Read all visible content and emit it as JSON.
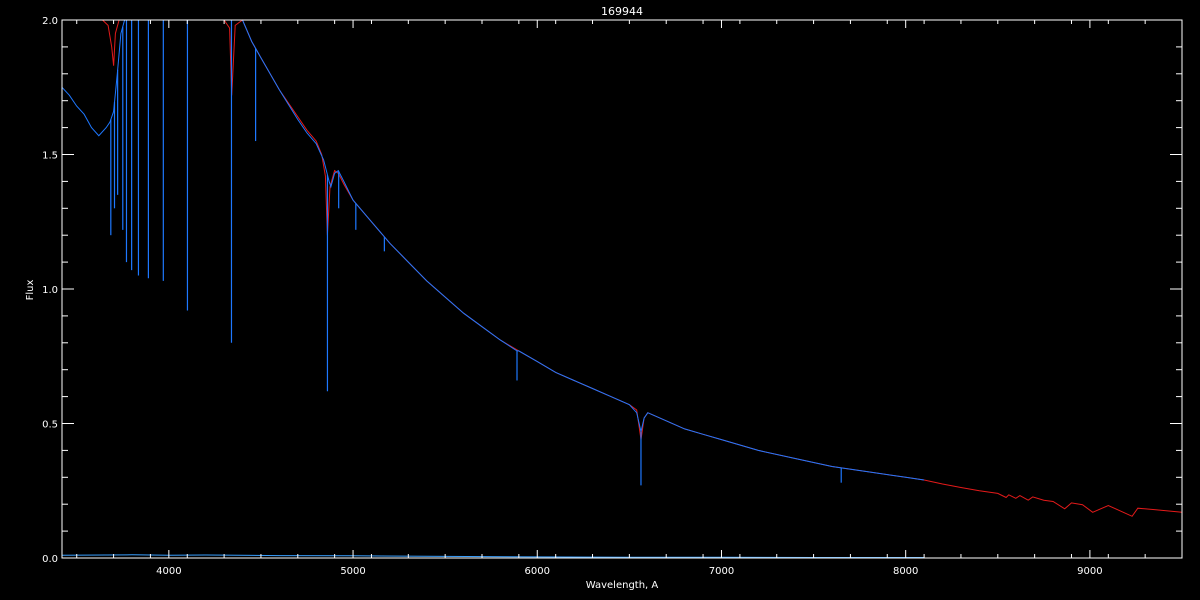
{
  "colors": {
    "background": "#000000",
    "axes": "#ffffff",
    "observed": "#1e78ff",
    "model": "#e41a1a",
    "error": "#3aa0ff"
  },
  "chart_data": {
    "type": "line",
    "title": "169944",
    "xlabel": "Wavelength, A",
    "ylabel": "Flux",
    "xlim": [
      3420,
      9500
    ],
    "ylim": [
      0.0,
      2.0
    ],
    "x_ticks": [
      4000,
      5000,
      6000,
      7000,
      8000,
      9000
    ],
    "y_ticks": [
      0.0,
      0.5,
      1.0,
      1.5,
      2.0
    ],
    "y_tick_labels": [
      "0.0",
      "0.5",
      "1.0",
      "1.5",
      "2.0"
    ],
    "grid": false,
    "legend": "none",
    "series": [
      {
        "color": "#e41a1a",
        "x": [
          3640,
          3670,
          3690,
          3700,
          3710,
          3730,
          3760,
          3800,
          4050,
          4100,
          4200,
          4300,
          4330,
          4341,
          4360,
          4400,
          4450,
          4500,
          4600,
          4700,
          4750,
          4800,
          4830,
          4850,
          4861,
          4875,
          4900,
          4920,
          4950,
          5000,
          5100,
          5200,
          5300,
          5400,
          5500,
          5600,
          5700,
          5800,
          5900,
          6000,
          6100,
          6200,
          6300,
          6400,
          6500,
          6540,
          6563,
          6580,
          6600,
          6700,
          6800,
          6900,
          7000,
          7200,
          7400,
          7600,
          7800,
          8000,
          8100,
          8200,
          8300,
          8400,
          8500,
          8545,
          8560,
          8598,
          8620,
          8665,
          8690,
          8750,
          8800,
          8863,
          8900,
          8960,
          9015,
          9100,
          9229,
          9260,
          9350,
          9500
        ],
        "y": [
          2.0,
          1.98,
          1.9,
          1.83,
          1.95,
          2.0,
          2.0,
          2.0,
          2.0,
          2.0,
          2.0,
          2.0,
          1.97,
          1.72,
          1.98,
          2.0,
          1.92,
          1.86,
          1.74,
          1.64,
          1.59,
          1.55,
          1.5,
          1.42,
          1.2,
          1.38,
          1.44,
          1.43,
          1.39,
          1.33,
          1.25,
          1.17,
          1.1,
          1.03,
          0.97,
          0.91,
          0.86,
          0.81,
          0.77,
          0.73,
          0.69,
          0.66,
          0.63,
          0.6,
          0.57,
          0.55,
          0.44,
          0.52,
          0.54,
          0.51,
          0.48,
          0.46,
          0.44,
          0.4,
          0.37,
          0.34,
          0.32,
          0.3,
          0.29,
          0.275,
          0.262,
          0.25,
          0.24,
          0.225,
          0.235,
          0.222,
          0.232,
          0.215,
          0.227,
          0.215,
          0.21,
          0.183,
          0.205,
          0.198,
          0.17,
          0.195,
          0.155,
          0.185,
          0.18,
          0.17
        ]
      },
      {
        "color": "#1e78ff",
        "x": [
          3420,
          3460,
          3500,
          3540,
          3580,
          3620,
          3660,
          3680,
          3700,
          3720,
          3740,
          3760,
          3780,
          3800,
          3900,
          4000,
          4050,
          4100,
          4200,
          4300,
          4350,
          4400,
          4450,
          4500,
          4600,
          4700,
          4750,
          4800,
          4840,
          4870,
          4880,
          4900,
          4920,
          4950,
          5000,
          5100,
          5200,
          5300,
          5400,
          5500,
          5600,
          5700,
          5800,
          5890,
          5900,
          6000,
          6100,
          6200,
          6300,
          6400,
          6500,
          6540,
          6563,
          6580,
          6600,
          6700,
          6800,
          6900,
          7000,
          7200,
          7400,
          7600,
          7800,
          8000,
          8100
        ],
        "y": [
          1.75,
          1.72,
          1.68,
          1.65,
          1.6,
          1.57,
          1.6,
          1.62,
          1.66,
          1.8,
          1.95,
          2.0,
          2.0,
          2.0,
          2.0,
          2.0,
          2.0,
          2.0,
          2.0,
          2.0,
          2.0,
          2.0,
          1.92,
          1.86,
          1.74,
          1.63,
          1.58,
          1.54,
          1.48,
          1.4,
          1.38,
          1.43,
          1.44,
          1.4,
          1.33,
          1.25,
          1.17,
          1.1,
          1.03,
          0.97,
          0.91,
          0.86,
          0.81,
          0.77,
          0.77,
          0.73,
          0.69,
          0.66,
          0.63,
          0.6,
          0.57,
          0.54,
          0.47,
          0.52,
          0.54,
          0.51,
          0.48,
          0.46,
          0.44,
          0.4,
          0.37,
          0.34,
          0.32,
          0.3,
          0.29
        ]
      },
      {
        "color": "#3aa0ff",
        "x": [
          3420,
          3800,
          4000,
          4200,
          4600,
          5000,
          5500,
          6000,
          6500,
          7000,
          7500,
          8100
        ],
        "y": [
          0.01,
          0.012,
          0.01,
          0.011,
          0.009,
          0.008,
          0.006,
          0.004,
          0.003,
          0.003,
          0.002,
          0.002
        ]
      }
    ],
    "absorption_lines": [
      {
        "x": 3685,
        "y": 1.2
      },
      {
        "x": 3705,
        "y": 1.3
      },
      {
        "x": 3722,
        "y": 1.35
      },
      {
        "x": 3750,
        "y": 1.22
      },
      {
        "x": 3770,
        "y": 1.1
      },
      {
        "x": 3798,
        "y": 1.07
      },
      {
        "x": 3835,
        "y": 1.05
      },
      {
        "x": 3889,
        "y": 1.04
      },
      {
        "x": 3970,
        "y": 1.03
      },
      {
        "x": 4101,
        "y": 0.92
      },
      {
        "x": 4340,
        "y": 0.8
      },
      {
        "x": 4471,
        "y": 1.55
      },
      {
        "x": 4861,
        "y": 0.62
      },
      {
        "x": 4922,
        "y": 1.3
      },
      {
        "x": 5015,
        "y": 1.22
      },
      {
        "x": 5170,
        "y": 1.14
      },
      {
        "x": 5890,
        "y": 0.66
      },
      {
        "x": 6563,
        "y": 0.27
      },
      {
        "x": 7650,
        "y": 0.28
      }
    ]
  }
}
